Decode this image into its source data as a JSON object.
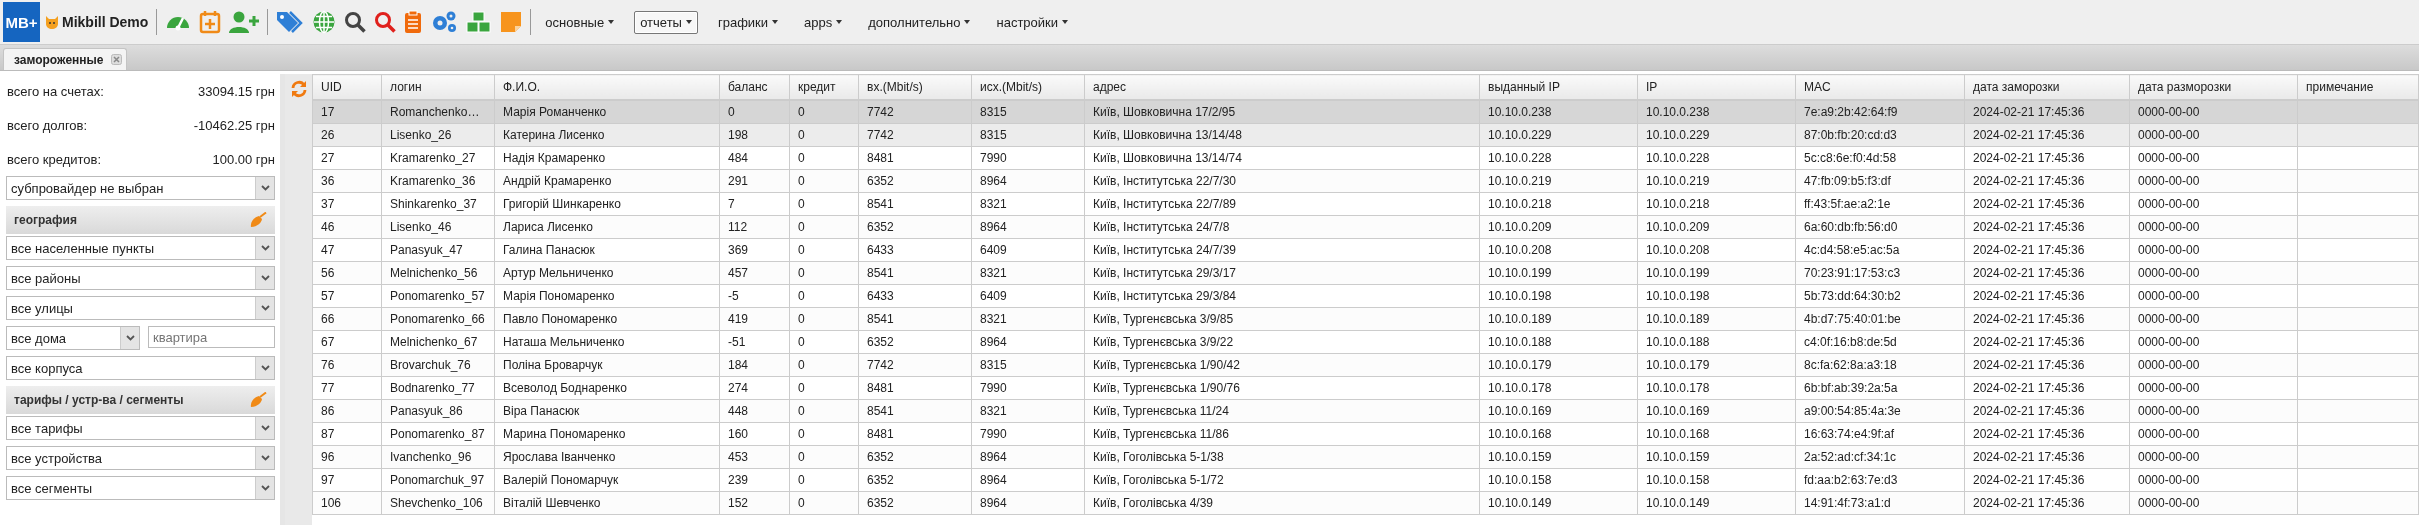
{
  "app": {
    "logo": "MB+",
    "title": "Mikbill Demo"
  },
  "menus": [
    {
      "label": "основные",
      "selected": false
    },
    {
      "label": "отчеты",
      "selected": true
    },
    {
      "label": "графики",
      "selected": false
    },
    {
      "label": "apps",
      "selected": false
    },
    {
      "label": "дополнительно",
      "selected": false
    },
    {
      "label": "настройки",
      "selected": false
    }
  ],
  "tabs": [
    {
      "label": "замороженные",
      "selected": true
    }
  ],
  "sidebar": {
    "totals": [
      {
        "label": "всего на счетах:",
        "value": "33094.15 грн"
      },
      {
        "label": "всего долгов:",
        "value": "-10462.25 грн"
      },
      {
        "label": "всего кредитов:",
        "value": "100.00 грн"
      }
    ],
    "subprovider": {
      "value": "субпровайдер не выбран"
    },
    "sections": [
      {
        "title": "география",
        "rows": [
          {
            "fields": [
              {
                "kind": "select",
                "value": "все населенные пункты"
              }
            ]
          },
          {
            "fields": [
              {
                "kind": "select",
                "value": "все районы"
              }
            ]
          },
          {
            "fields": [
              {
                "kind": "select",
                "value": "все улицы"
              }
            ]
          },
          {
            "fields": [
              {
                "kind": "select",
                "value": "все дома"
              },
              {
                "kind": "input",
                "placeholder": "квартира"
              }
            ]
          },
          {
            "fields": [
              {
                "kind": "select",
                "value": "все корпуса"
              }
            ]
          }
        ]
      },
      {
        "title": "тарифы / устр-ва / сегменты",
        "rows": [
          {
            "fields": [
              {
                "kind": "select",
                "value": "все тарифы"
              }
            ]
          },
          {
            "fields": [
              {
                "kind": "select",
                "value": "все устройства"
              }
            ]
          },
          {
            "fields": [
              {
                "kind": "select",
                "value": "все сегменты"
              }
            ]
          }
        ]
      }
    ]
  },
  "table": {
    "columns": [
      "UID",
      "логин",
      "Ф.И.О.",
      "баланс",
      "кредит",
      "вх.(Mbit/s)",
      "исх.(Mbit/s)",
      "адрес",
      "выданный IP",
      "IP",
      "MAC",
      "дата заморозки",
      "дата разморозки",
      "примечание"
    ],
    "rows": [
      {
        "selected": true,
        "hovered": false,
        "cells": [
          "17",
          "Romanchenko…",
          "Марія Романченко",
          "0",
          "0",
          "7742",
          "8315",
          "Київ, Шовковична 17/2/95",
          "10.10.0.238",
          "10.10.0.238",
          "7e:a9:2b:42:64:f9",
          "2024-02-21 17:45:36",
          "0000-00-00"
        ]
      },
      {
        "selected": false,
        "hovered": true,
        "cells": [
          "26",
          "Lisenko_26",
          "Катерина Лисенко",
          "198",
          "0",
          "7742",
          "8315",
          "Київ, Шовковична 13/14/48",
          "10.10.0.229",
          "10.10.0.229",
          "87:0b:fb:20:cd:d3",
          "2024-02-21 17:45:36",
          "0000-00-00"
        ]
      },
      {
        "selected": false,
        "hovered": false,
        "cells": [
          "27",
          "Kramarenko_27",
          "Надія Крамаренко",
          "484",
          "0",
          "8481",
          "7990",
          "Київ, Шовковична 13/14/74",
          "10.10.0.228",
          "10.10.0.228",
          "5c:c8:6e:f0:4d:58",
          "2024-02-21 17:45:36",
          "0000-00-00"
        ]
      },
      {
        "selected": false,
        "hovered": false,
        "cells": [
          "36",
          "Kramarenko_36",
          "Андрій Крамаренко",
          "291",
          "0",
          "6352",
          "8964",
          "Київ, Інститутська 22/7/30",
          "10.10.0.219",
          "10.10.0.219",
          "47:fb:09:b5:f3:df",
          "2024-02-21 17:45:36",
          "0000-00-00"
        ]
      },
      {
        "selected": false,
        "hovered": false,
        "cells": [
          "37",
          "Shinkarenko_37",
          "Григорій Шинкаренко",
          "7",
          "0",
          "8541",
          "8321",
          "Київ, Інститутська 22/7/89",
          "10.10.0.218",
          "10.10.0.218",
          "ff:43:5f:ae:a2:1e",
          "2024-02-21 17:45:36",
          "0000-00-00"
        ]
      },
      {
        "selected": false,
        "hovered": false,
        "cells": [
          "46",
          "Lisenko_46",
          "Лариса Лисенко",
          "112",
          "0",
          "6352",
          "8964",
          "Київ, Інститутська 24/7/8",
          "10.10.0.209",
          "10.10.0.209",
          "6a:60:db:fb:56:d0",
          "2024-02-21 17:45:36",
          "0000-00-00"
        ]
      },
      {
        "selected": false,
        "hovered": false,
        "cells": [
          "47",
          "Panasyuk_47",
          "Галина Панасюк",
          "369",
          "0",
          "6433",
          "6409",
          "Київ, Інститутська 24/7/39",
          "10.10.0.208",
          "10.10.0.208",
          "4c:d4:58:e5:ac:5a",
          "2024-02-21 17:45:36",
          "0000-00-00"
        ]
      },
      {
        "selected": false,
        "hovered": false,
        "cells": [
          "56",
          "Melnichenko_56",
          "Артур Мельниченко",
          "457",
          "0",
          "8541",
          "8321",
          "Київ, Інститутська 29/3/17",
          "10.10.0.199",
          "10.10.0.199",
          "70:23:91:17:53:c3",
          "2024-02-21 17:45:36",
          "0000-00-00"
        ]
      },
      {
        "selected": false,
        "hovered": false,
        "cells": [
          "57",
          "Ponomarenko_57",
          "Марія Пономаренко",
          "-5",
          "0",
          "6433",
          "6409",
          "Київ, Інститутська 29/3/84",
          "10.10.0.198",
          "10.10.0.198",
          "5b:73:dd:64:30:b2",
          "2024-02-21 17:45:36",
          "0000-00-00"
        ]
      },
      {
        "selected": false,
        "hovered": false,
        "cells": [
          "66",
          "Ponomarenko_66",
          "Павло Пономаренко",
          "419",
          "0",
          "8541",
          "8321",
          "Київ, Тургенєвська 3/9/85",
          "10.10.0.189",
          "10.10.0.189",
          "4b:d7:75:40:01:be",
          "2024-02-21 17:45:36",
          "0000-00-00"
        ]
      },
      {
        "selected": false,
        "hovered": false,
        "cells": [
          "67",
          "Melnichenko_67",
          "Наташа Мельниченко",
          "-51",
          "0",
          "6352",
          "8964",
          "Київ, Тургенєвська 3/9/22",
          "10.10.0.188",
          "10.10.0.188",
          "c4:0f:16:b8:de:5d",
          "2024-02-21 17:45:36",
          "0000-00-00"
        ]
      },
      {
        "selected": false,
        "hovered": false,
        "cells": [
          "76",
          "Brovarchuk_76",
          "Поліна Броварчук",
          "184",
          "0",
          "7742",
          "8315",
          "Київ, Тургенєвська 1/90/42",
          "10.10.0.179",
          "10.10.0.179",
          "8c:fa:62:8a:a3:18",
          "2024-02-21 17:45:36",
          "0000-00-00"
        ]
      },
      {
        "selected": false,
        "hovered": false,
        "cells": [
          "77",
          "Bodnarenko_77",
          "Всеволод Боднаренко",
          "274",
          "0",
          "8481",
          "7990",
          "Київ, Тургенєвська 1/90/76",
          "10.10.0.178",
          "10.10.0.178",
          "6b:bf:ab:39:2a:5a",
          "2024-02-21 17:45:36",
          "0000-00-00"
        ]
      },
      {
        "selected": false,
        "hovered": false,
        "cells": [
          "86",
          "Panasyuk_86",
          "Віра Панасюк",
          "448",
          "0",
          "8541",
          "8321",
          "Київ, Тургенєвська 11/24",
          "10.10.0.169",
          "10.10.0.169",
          "a9:00:54:85:4a:3e",
          "2024-02-21 17:45:36",
          "0000-00-00"
        ]
      },
      {
        "selected": false,
        "hovered": false,
        "cells": [
          "87",
          "Ponomarenko_87",
          "Марина Пономаренко",
          "160",
          "0",
          "8481",
          "7990",
          "Київ, Тургенєвська 11/86",
          "10.10.0.168",
          "10.10.0.168",
          "16:63:74:e4:9f:af",
          "2024-02-21 17:45:36",
          "0000-00-00"
        ]
      },
      {
        "selected": false,
        "hovered": false,
        "cells": [
          "96",
          "Ivanchenko_96",
          "Ярослава Іванченко",
          "453",
          "0",
          "6352",
          "8964",
          "Київ, Гоголівська 5-1/38",
          "10.10.0.159",
          "10.10.0.159",
          "2a:52:ad:cf:34:1c",
          "2024-02-21 17:45:36",
          "0000-00-00"
        ]
      },
      {
        "selected": false,
        "hovered": false,
        "cells": [
          "97",
          "Ponomarchuk_97",
          "Валерій Пономарчук",
          "239",
          "0",
          "6352",
          "8964",
          "Київ, Гоголівська 5-1/72",
          "10.10.0.158",
          "10.10.0.158",
          "fd:aa:b2:63:7e:d3",
          "2024-02-21 17:45:36",
          "0000-00-00"
        ]
      },
      {
        "selected": false,
        "hovered": false,
        "cells": [
          "106",
          "Shevchenko_106",
          "Віталій Шевченко",
          "152",
          "0",
          "6352",
          "8964",
          "Київ, Гоголівська 4/39",
          "10.10.0.149",
          "10.10.0.149",
          "14:91:4f:73:a1:d",
          "2024-02-21 17:45:36",
          "0000-00-00"
        ]
      }
    ]
  }
}
